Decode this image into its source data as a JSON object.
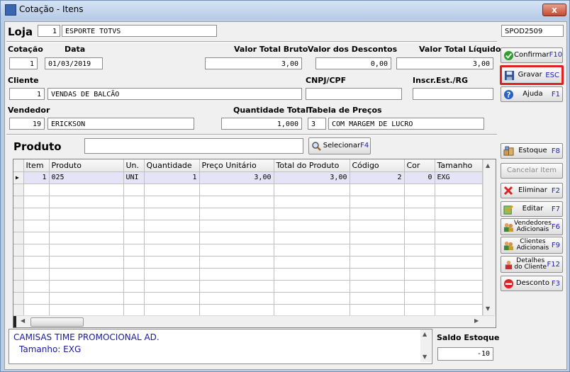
{
  "window": {
    "title": "Cotação - Itens",
    "close_label": "x"
  },
  "loja": {
    "label": "Loja",
    "code": "1",
    "name": "ESPORTE TOTVS"
  },
  "spod": "SPOD2509",
  "cotacao": {
    "label": "Cotação",
    "value": "1"
  },
  "data": {
    "label": "Data",
    "value": "01/03/2019"
  },
  "valor_bruto": {
    "label": "Valor Total Bruto",
    "value": "3,00"
  },
  "valor_desc": {
    "label": "Valor dos Descontos",
    "value": "0,00"
  },
  "valor_liq": {
    "label": "Valor Total Líquido",
    "value": "3,00"
  },
  "cliente": {
    "label": "Cliente",
    "code": "1",
    "name": "VENDAS DE BALCÃO"
  },
  "cnpj": {
    "label": "CNPJ/CPF",
    "value": ""
  },
  "inscr": {
    "label": "Inscr.Est./RG",
    "value": ""
  },
  "vendedor": {
    "label": "Vendedor",
    "code": "19",
    "name": "ERICKSON"
  },
  "quantidade": {
    "label": "Quantidade Total",
    "value": "1,000"
  },
  "tabela": {
    "label": "Tabela de Preços",
    "code": "3",
    "name": "COM MARGEM DE LUCRO"
  },
  "produto": {
    "label": "Produto",
    "value": "",
    "select_label": "Selecionar",
    "select_key": "F4"
  },
  "buttons": {
    "confirmar": {
      "label": "Confirmar",
      "key": "F10"
    },
    "gravar": {
      "label": "Gravar",
      "key": "ESC"
    },
    "ajuda": {
      "label": "Ajuda",
      "key": "F1"
    },
    "estoque": {
      "label": "Estoque",
      "key": "F8"
    },
    "cancelar": {
      "label": "Cancelar Item",
      "key": ""
    },
    "eliminar": {
      "label": "Eliminar",
      "key": "F2"
    },
    "editar": {
      "label": "Editar",
      "key": "F7"
    },
    "vendedores": {
      "line1": "Vendedores",
      "line2": "Adicionais",
      "key": "F6"
    },
    "clientes": {
      "line1": "Clientes",
      "line2": "Adicionais",
      "key": "F9"
    },
    "detalhes": {
      "line1": "Detalhes",
      "line2": "do Cliente",
      "key": "F12"
    },
    "desconto": {
      "label": "Desconto",
      "key": "F3"
    }
  },
  "grid": {
    "columns": [
      "Item",
      "Produto",
      "Un.",
      "Quantidade",
      "Preço Unitário",
      "Total do Produto",
      "Código",
      "Cor",
      "Tamanho"
    ],
    "rows": [
      [
        "1",
        "025",
        "UNI",
        "1",
        "3,00",
        "3,00",
        "2",
        "0",
        "EXG"
      ]
    ]
  },
  "description": {
    "line1": "CAMISAS TIME PROMOCIONAL AD.",
    "line2": "Tamanho: EXG"
  },
  "saldo": {
    "label": "Saldo Estoque",
    "value": "-10"
  },
  "colors": {
    "highlight": "#e02020",
    "key_blue": "#2020b8",
    "desc_blue": "#1a1a9e"
  }
}
